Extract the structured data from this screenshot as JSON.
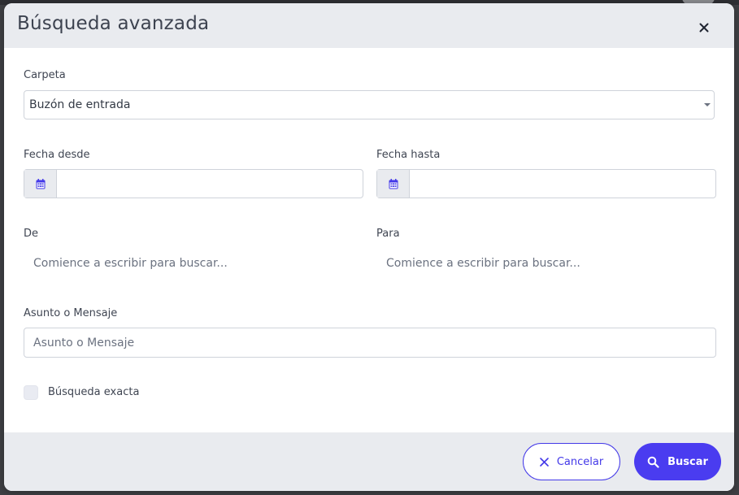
{
  "dialog": {
    "title": "Búsqueda avanzada"
  },
  "form": {
    "folder_label": "Carpeta",
    "folder_value": "Buzón de entrada",
    "date_from_label": "Fecha desde",
    "date_to_label": "Fecha hasta",
    "date_from_value": "",
    "date_to_value": "",
    "from_label": "De",
    "from_placeholder": "Comience a escribir para buscar...",
    "to_label": "Para",
    "to_placeholder": "Comience a escribir para buscar...",
    "subject_label": "Asunto o Mensaje",
    "subject_placeholder": "Asunto o Mensaje",
    "exact_label": "Búsqueda exacta",
    "exact_checked": false
  },
  "footer": {
    "cancel_label": "Cancelar",
    "search_label": "Buscar"
  },
  "colors": {
    "accent": "#4a3cf0",
    "header_bg": "#e9ebef",
    "calendar_icon": "#4338e8"
  },
  "icons": {
    "close": "close-icon",
    "calendar": "calendar-icon",
    "cancel": "x-icon",
    "search": "search-icon",
    "caret": "caret-down-icon"
  }
}
